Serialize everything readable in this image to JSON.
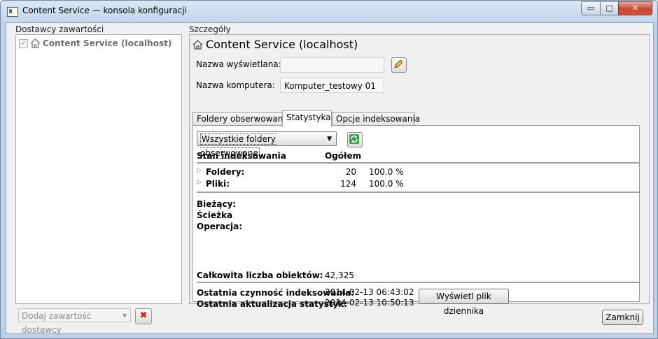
{
  "window": {
    "title": "Content Service — konsola konfiguracji",
    "controls": {
      "minimize": "▭",
      "maximize": "□",
      "close": "✕"
    }
  },
  "providers": {
    "group_label": "Dostawcy zawartości",
    "items": [
      {
        "label": "Content Service (localhost)",
        "checked": true,
        "icon": "house-icon"
      }
    ],
    "add_combo": "Dodaj zawartość dostawcy",
    "delete_icon": "✖"
  },
  "details": {
    "group_label": "Szczegóły",
    "heading": "Content Service (localhost)",
    "display_name_label": "Nazwa wyświetlana:",
    "display_name_value": "",
    "computer_name_label": "Nazwa komputera:",
    "computer_name_value": "Komputer_testowy 01",
    "tabs": [
      {
        "label": "Foldery obserwowane",
        "active": false
      },
      {
        "label": "Statystyka",
        "active": true
      },
      {
        "label": "Opcje indeksowania",
        "active": false
      }
    ],
    "stats": {
      "folder_filter": "Wszystkie foldery obserwowane",
      "col_state": "Stan indeksowania",
      "col_total": "Ogółem",
      "rows": [
        {
          "label": "Foldery:",
          "count": "20",
          "percent": "100.0 %"
        },
        {
          "label": "Pliki:",
          "count": "124",
          "percent": "100.0 %"
        }
      ],
      "current_label": "Bieżący:",
      "path_label": "Ścieżka",
      "operation_label": "Operacja:",
      "total_objects_label": "Całkowita liczba obiektów:",
      "total_objects_value": "42,325",
      "last_indexing_label": "Ostatnia czynność indeksowania:",
      "last_indexing_value": "2014-02-13 06:43:02",
      "last_stats_update_label": "Ostatnia aktualizacja statystyk:",
      "last_stats_update_value": "2014-02-13 10:50:13",
      "view_log_button": "Wyświetl plik dziennika"
    }
  },
  "footer": {
    "close_button": "Zamknij"
  }
}
